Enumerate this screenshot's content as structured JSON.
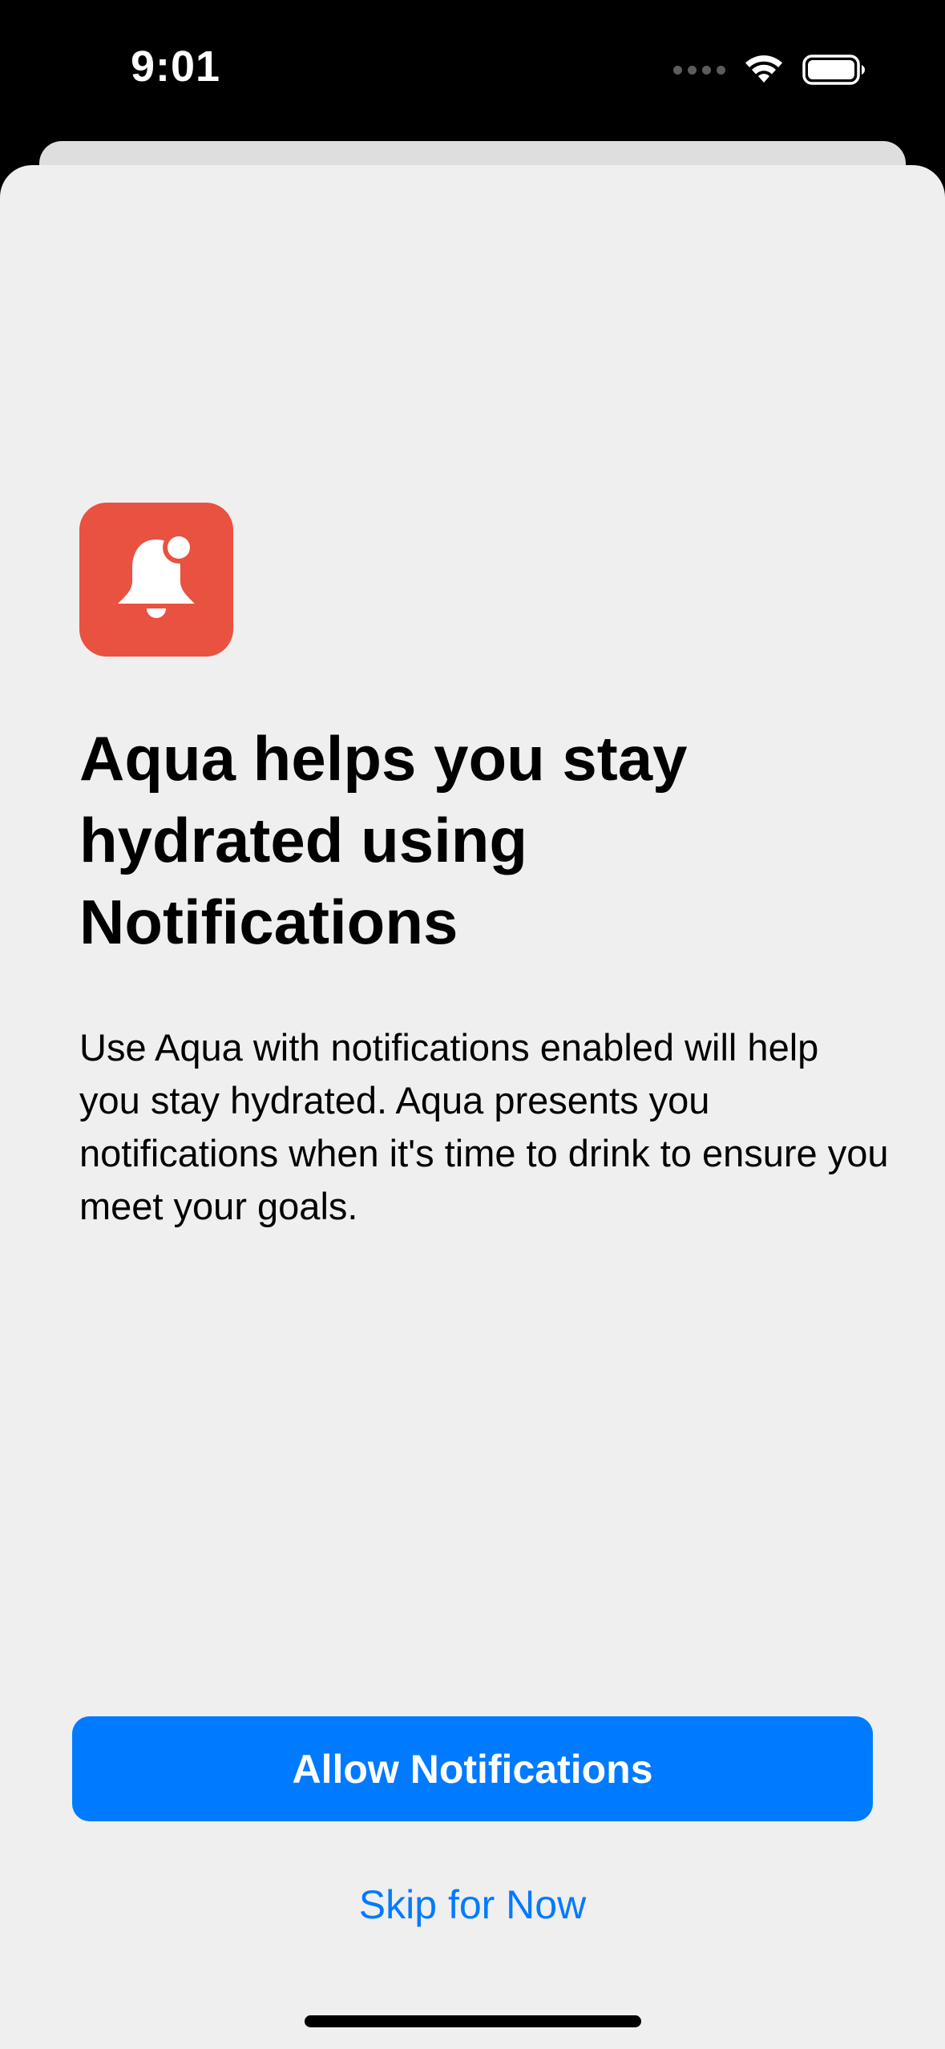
{
  "status_bar": {
    "time": "9:01",
    "icons": [
      "cellular-signal-icon",
      "wifi-icon",
      "battery-icon"
    ]
  },
  "onboarding": {
    "icon": "bell-badge-icon",
    "icon_color": "#e95140",
    "title": "Aqua helps you stay hydrated using Notifications",
    "description": "Use Aqua with notifications enabled will help you stay hydrated. Aqua presents you notifications when it's time to drink to ensure you meet your goals."
  },
  "actions": {
    "primary_label": "Allow Notifications",
    "secondary_label": "Skip for Now",
    "accent_color": "#007aff"
  }
}
